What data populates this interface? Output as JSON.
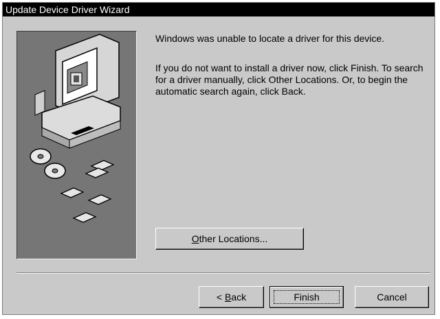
{
  "window": {
    "title": "Update Device Driver Wizard"
  },
  "message": {
    "primary": "Windows was unable to locate a driver for this device.",
    "secondary": "If you do not want to install a driver now, click Finish. To search for a driver manually, click Other Locations. Or, to begin the automatic search again, click Back."
  },
  "buttons": {
    "other_locations": {
      "accel": "O",
      "rest": "ther Locations..."
    },
    "back": {
      "prefix": "< ",
      "accel": "B",
      "rest": "ack"
    },
    "finish": "Finish",
    "cancel": "Cancel"
  },
  "icons": [
    "computer-icon",
    "cd-icon",
    "floppy-disk-icon"
  ],
  "colors": {
    "titlebar": "#000000",
    "dialog": "#c9c9c9",
    "art_panel": "#767676"
  }
}
